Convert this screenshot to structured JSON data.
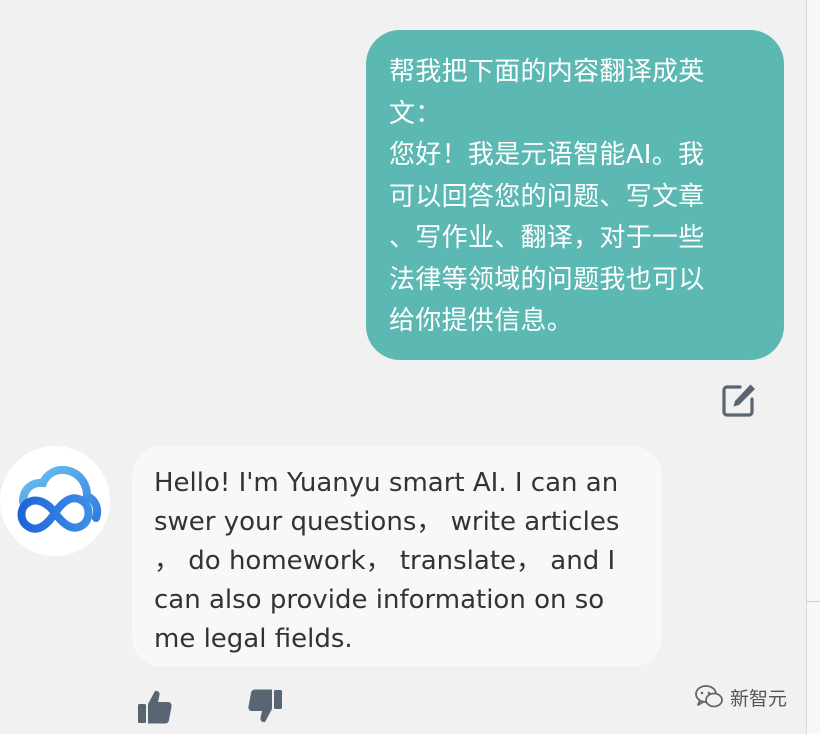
{
  "conversation": {
    "user_message": "帮我把下面的内容翻译成英\n文：\n您好！我是元语智能AI。我\n可以回答您的问题、写文章\n、写作业、翻译，对于一些\n法律等领域的问题我也可以\n给你提供信息。",
    "ai_message": "Hello! I'm Yuanyu smart AI. I can an\nswer your questions，  write articles\n，  do homework，  translate，  and I\ncan also provide information on so\nme legal fields."
  },
  "icons": {
    "edit": "edit-icon",
    "avatar": "cloud-infinity-logo",
    "like": "thumbs-up-icon",
    "dislike": "thumbs-down-icon",
    "watermark": "wechat-icon"
  },
  "colors": {
    "user_bubble": "#5cb8b2",
    "ai_bubble": "#f8f8f8",
    "icon": "#5a6574",
    "logo_blue": "#2f7fe0"
  },
  "watermark": {
    "text": "新智元"
  }
}
